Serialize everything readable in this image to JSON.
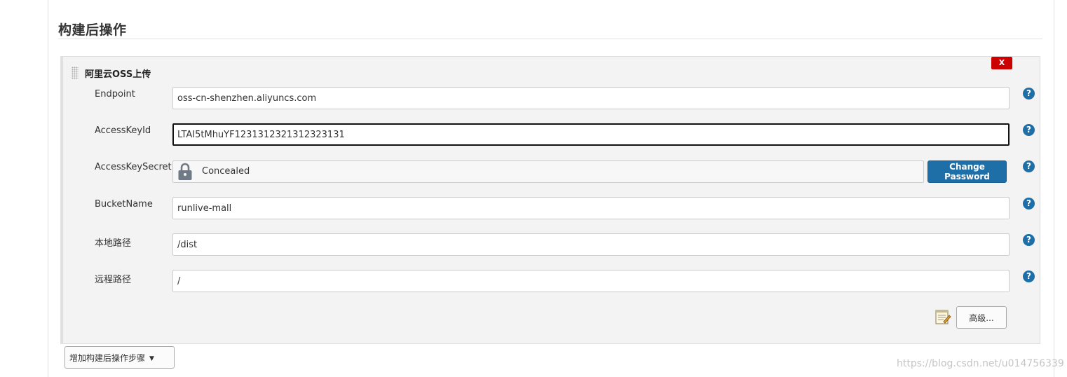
{
  "section": {
    "title": "构建后操作"
  },
  "plugin": {
    "title": "阿里云OSS上传",
    "delete_label": "X",
    "fields": [
      {
        "label": "Endpoint",
        "value": "oss-cn-shenzhen.aliyuncs.com"
      },
      {
        "label": "AccessKeyId",
        "value": "LTAI5tMhuYF1231312321312323131"
      },
      {
        "label": "AccessKeySecret",
        "value": "Concealed"
      },
      {
        "label": "BucketName",
        "value": "runlive-mall"
      },
      {
        "label": "本地路径",
        "value": "/dist"
      },
      {
        "label": "远程路径",
        "value": "/"
      }
    ],
    "change_password_label": "Change Password",
    "advanced_label": "高级...",
    "help_glyph": "?"
  },
  "footer": {
    "add_step_label": "增加构建后操作步骤"
  },
  "watermark": "https://blog.csdn.net/u014756339",
  "icons": {
    "help": "help-icon",
    "lock": "lock-icon",
    "notepad": "notepad-icon",
    "drag": "drag-handle-icon",
    "caret": "caret-down-icon"
  },
  "colors": {
    "accent": "#1e6fa8",
    "delete": "#cc0000",
    "panel_bg": "#f3f3f3"
  }
}
